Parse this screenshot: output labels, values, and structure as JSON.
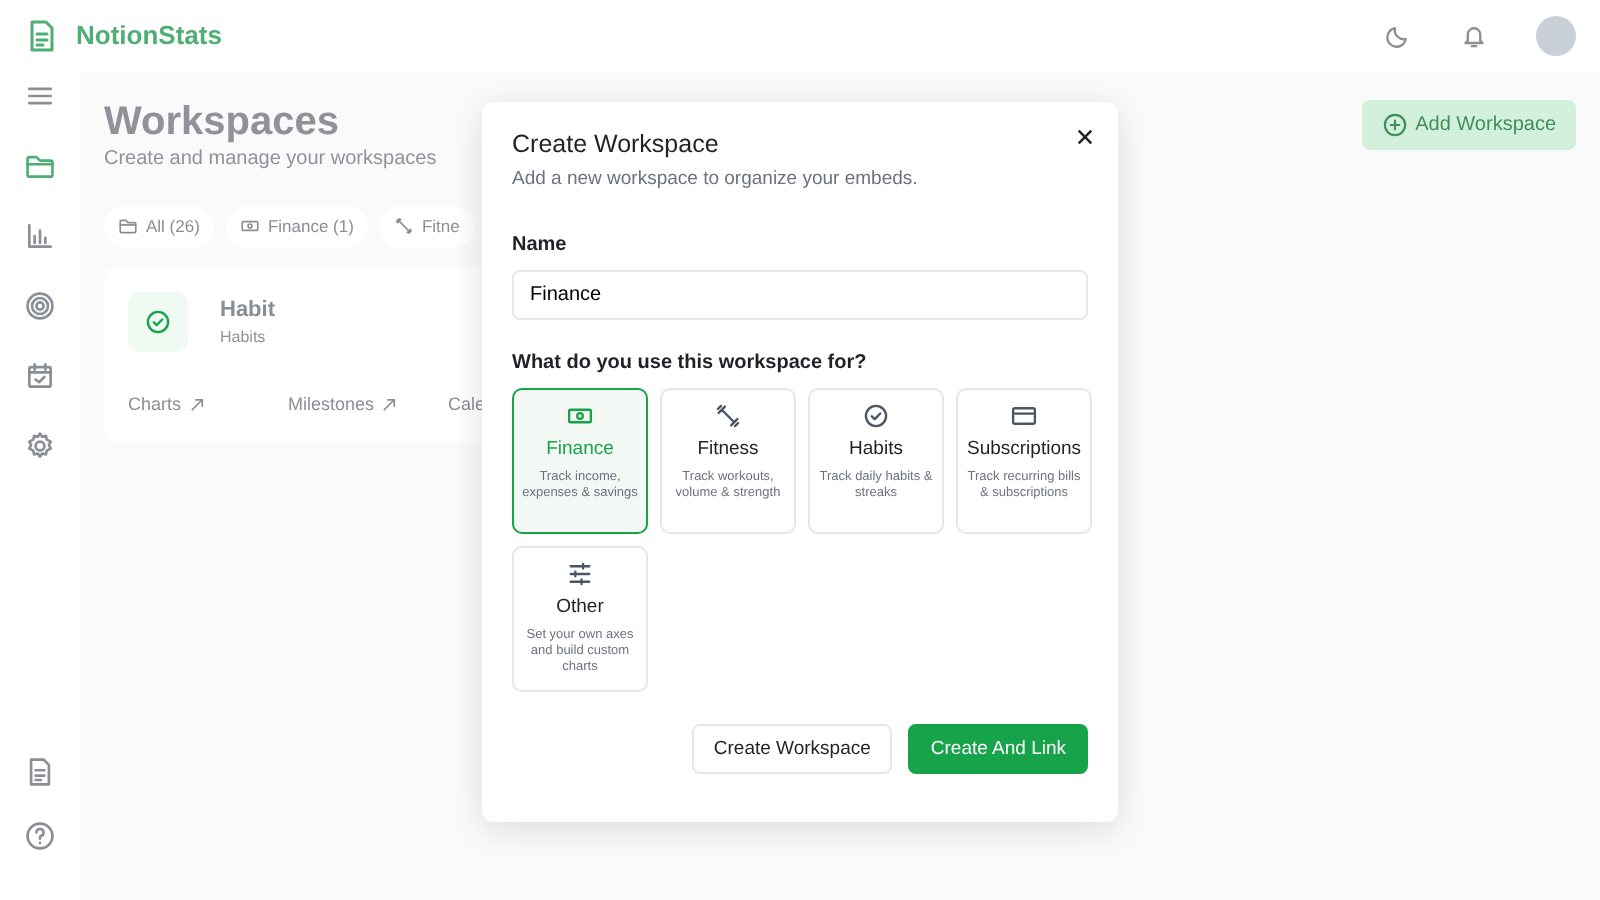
{
  "app": {
    "name": "NotionStats"
  },
  "sidebar": {
    "items": [
      {
        "kind": "menu",
        "selected": false
      },
      {
        "kind": "folder",
        "selected": true
      },
      {
        "kind": "chart",
        "selected": false
      },
      {
        "kind": "target",
        "selected": false
      },
      {
        "kind": "calendar",
        "selected": false
      },
      {
        "kind": "settings",
        "selected": false
      }
    ],
    "bottom_items": [
      {
        "kind": "document",
        "selected": false
      },
      {
        "kind": "help",
        "selected": false
      }
    ]
  },
  "page": {
    "title": "Workspaces",
    "subtitle": "Create and manage your workspaces",
    "add_button": "Add Workspace"
  },
  "filters": [
    {
      "kind": "folder",
      "label": "All",
      "count": "(26)"
    },
    {
      "kind": "money",
      "label": "Finance",
      "count": "(1)"
    },
    {
      "kind": "dumbbell",
      "label": "Fitne"
    }
  ],
  "workspace_card": {
    "title": "Habit",
    "subtitle": "Habits",
    "links": [
      "Charts",
      "Milestones",
      "Cale"
    ]
  },
  "modal": {
    "title": "Create Workspace",
    "subtitle": "Add a new workspace to organize your embeds.",
    "name_label": "Name",
    "name_value": "Finance",
    "question": "What do you use this workspace for?",
    "categories": [
      {
        "kind": "finance",
        "title": "Finance",
        "description": "Track income, expenses & savings",
        "selected": true
      },
      {
        "kind": "fitness",
        "title": "Fitness",
        "description": "Track workouts, volume & strength",
        "selected": false
      },
      {
        "kind": "habits",
        "title": "Habits",
        "description": "Track daily habits & streaks",
        "selected": false
      },
      {
        "kind": "subscriptions",
        "title": "Subscriptions",
        "description": "Track recurring bills & subscriptions",
        "selected": false
      },
      {
        "kind": "other",
        "title": "Other",
        "description": "Set your own axes and build custom charts",
        "selected": false
      }
    ],
    "buttons": [
      {
        "kind": "outline",
        "label": "Create Workspace"
      },
      {
        "kind": "primary",
        "label": "Create And Link"
      }
    ]
  }
}
